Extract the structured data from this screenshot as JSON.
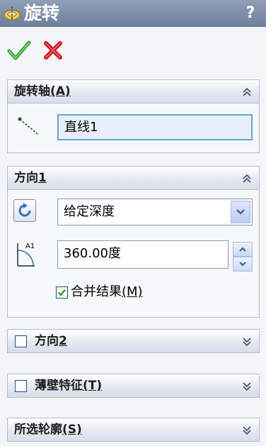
{
  "window": {
    "title": "旋转",
    "help": "?"
  },
  "sections": {
    "axis": {
      "title": "旋转轴",
      "hotkey": "(A)",
      "field_value": "直线1"
    },
    "direction1": {
      "title": "方向",
      "hotkey_num": "1",
      "end_condition": "给定深度",
      "angle": "360.00度",
      "merge_label": "合并结果",
      "merge_hotkey": "(M)",
      "merge_checked": true
    },
    "direction2": {
      "title": "方向",
      "hotkey_num": "2",
      "checked": false
    },
    "thin_feature": {
      "title": "薄壁特征",
      "hotkey": "(T)",
      "checked": false
    },
    "selected_contours": {
      "title": "所选轮廓",
      "hotkey": "(S)"
    }
  }
}
